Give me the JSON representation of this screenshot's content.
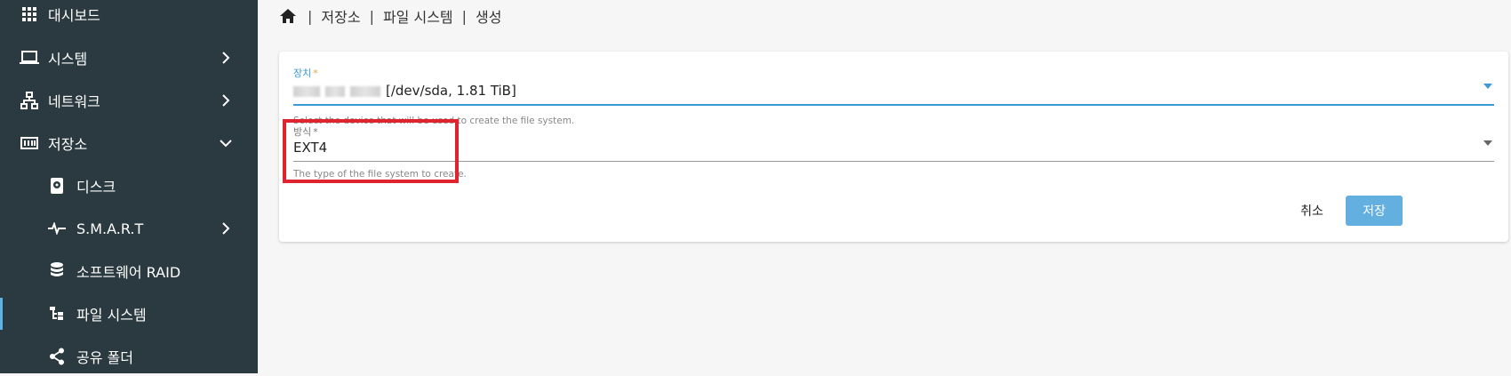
{
  "sidebar": {
    "items": [
      {
        "label": "대시보드",
        "icon": "grid-icon"
      },
      {
        "label": "시스템",
        "icon": "laptop-icon"
      },
      {
        "label": "네트워크",
        "icon": "network-icon"
      },
      {
        "label": "저장소",
        "icon": "storage-icon"
      },
      {
        "label": "디스크",
        "icon": "disk-icon"
      },
      {
        "label": "S.M.A.R.T",
        "icon": "pulse-icon"
      },
      {
        "label": "소프트웨어 RAID",
        "icon": "database-icon"
      },
      {
        "label": "파일 시스템",
        "icon": "tree-icon"
      },
      {
        "label": "공유 폴더",
        "icon": "share-icon"
      }
    ]
  },
  "breadcrumb": {
    "items": [
      "저장소",
      "파일 시스템",
      "생성"
    ],
    "separator": "|"
  },
  "form": {
    "device": {
      "label": "장치",
      "required_mark": "*",
      "value": "[/dev/sda, 1.81 TiB]",
      "hint": "Select the device that will be used to create the file system."
    },
    "type": {
      "label": "방식",
      "required_mark": "*",
      "value": "EXT4",
      "hint": "The type of the file system to create."
    },
    "cancel_label": "취소",
    "save_label": "저장"
  },
  "colors": {
    "sidebar_bg": "#2b3a40",
    "accent": "#5cb3e6",
    "save_button": "#63b0e0",
    "highlight_box": "#e0242f"
  }
}
